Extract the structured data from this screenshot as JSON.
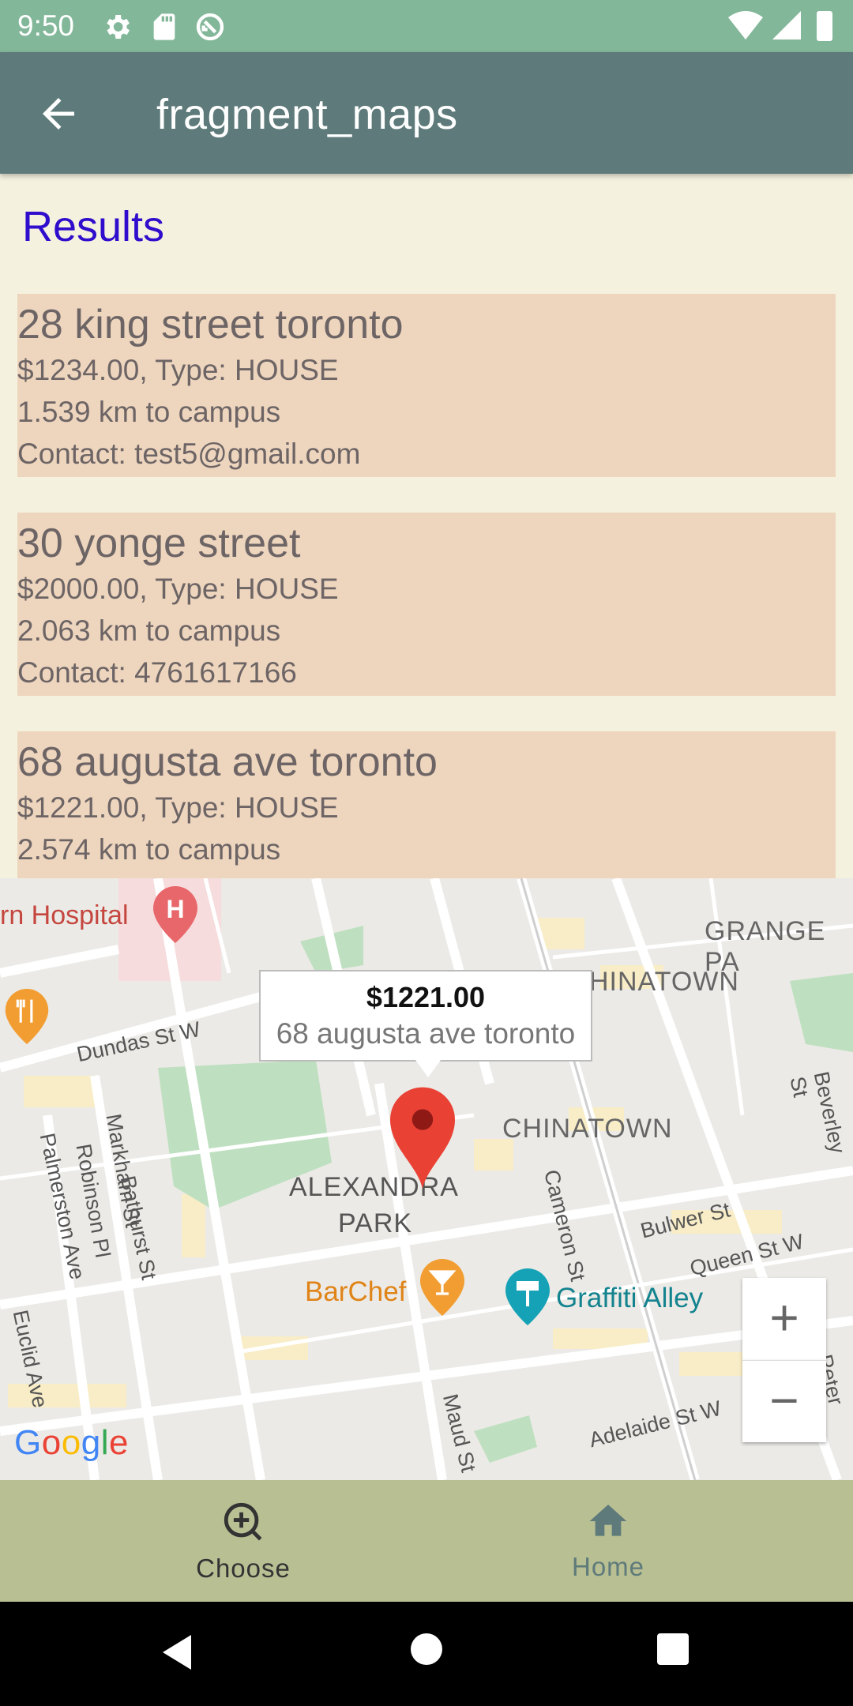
{
  "status_bar": {
    "time": "9:50"
  },
  "app_bar": {
    "title": "fragment_maps"
  },
  "results": {
    "heading": "Results",
    "items": [
      {
        "address": "28 king street toronto",
        "price_type": "$1234.00, Type: HOUSE",
        "distance": "1.539 km to campus",
        "contact": "Contact: test5@gmail.com"
      },
      {
        "address": "30 yonge street",
        "price_type": "$2000.00, Type: HOUSE",
        "distance": "2.063 km to campus",
        "contact": "Contact: 4761617166"
      },
      {
        "address": "68 augusta ave toronto",
        "price_type": "$1221.00, Type: HOUSE",
        "distance": "2.574 km to campus",
        "contact": ""
      }
    ]
  },
  "map": {
    "info_window": {
      "price": "$1221.00",
      "place": "68 augusta ave toronto"
    },
    "labels": {
      "hospital": "rn Hospital",
      "grange": "GRANGE PA",
      "chinatown_top": "HINATOWN",
      "chinatown": "CHINATOWN",
      "dundas": "Dundas St W",
      "alexandra": "ALEXANDRA",
      "park": "PARK",
      "bathurst": "Bathurst St",
      "markham": "Markham St",
      "robinson": "Robinson Pl",
      "palmerston": "Palmerston Ave",
      "euclid": "Euclid Ave",
      "cameron": "Cameron St",
      "bulwer": "Bulwer St",
      "queen": "Queen St W",
      "beverley": "Beverley St",
      "barchef": "BarChef",
      "graffiti": "Graffiti Alley",
      "maud": "Maud St",
      "adelaide": "Adelaide St W",
      "peter": "Peter St",
      "google": "Google"
    },
    "zoom_in": "+",
    "zoom_out": "−"
  },
  "bottom_nav": {
    "choose": "Choose",
    "home": "Home"
  },
  "colors": {
    "status_bar": "#83b79a",
    "app_bar": "#5e7a7a",
    "background": "#f5f1df",
    "card": "#eed5be",
    "heading": "#2f0dcc",
    "bottom_nav": "#b8bf93"
  }
}
